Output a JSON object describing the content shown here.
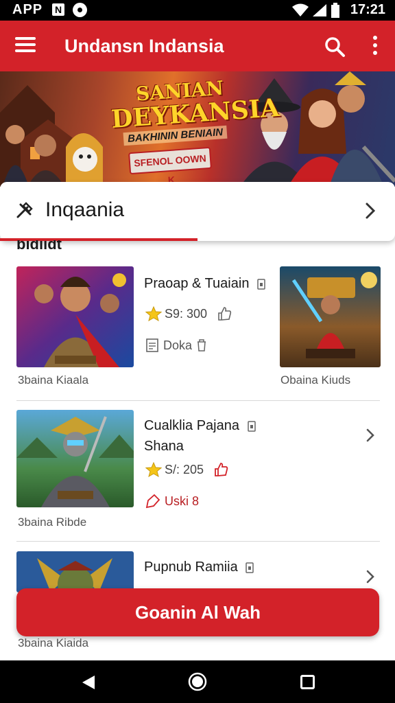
{
  "status_bar": {
    "app_label": "APP",
    "notification_letter": "N",
    "time": "17:21"
  },
  "app_bar": {
    "title": "Undansn Indansia"
  },
  "banner": {
    "title_line1": "SANIAN",
    "title_line2": "DEYKANSIA",
    "subtitle": "BAKHININ BENIAIN",
    "button_label": "SFENOL OOWN K"
  },
  "category": {
    "label": "Inqaania"
  },
  "section": {
    "label": "bidiidt"
  },
  "items": [
    {
      "title": "Praoap & Tuaiain",
      "rating": "S9: 300",
      "meta": "Doka",
      "thumb_caption": "3baina Kiaala",
      "side_caption": "Obaina Kiuds"
    },
    {
      "title_line1": "Cualklia Pajana",
      "title_line2": "Shana",
      "rating": "S/: 205",
      "meta": "Uski 8",
      "thumb_caption": "3baina Ribde"
    },
    {
      "title": "Pupnub Ramiia",
      "thumb_caption": "3baina Kiaida"
    }
  ],
  "cta": {
    "label": "Goanin Al Wah"
  },
  "colors": {
    "primary": "#d32229",
    "star": "#f5c518",
    "text": "#1a1a1a"
  }
}
